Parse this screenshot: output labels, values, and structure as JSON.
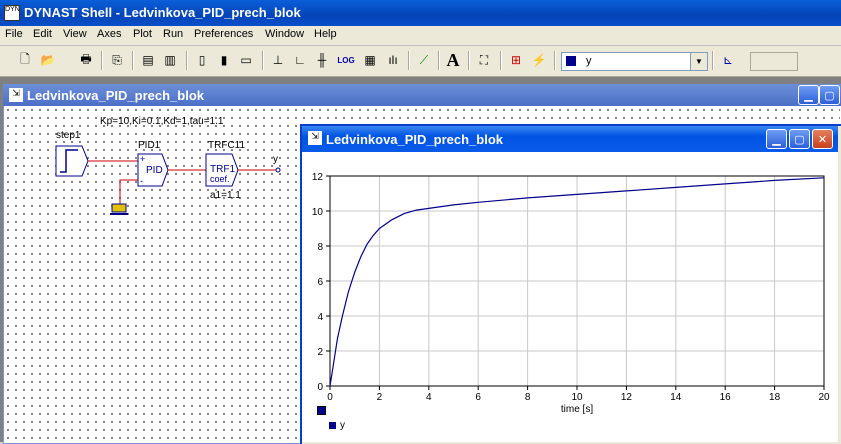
{
  "app": {
    "title": "DYNAST Shell - Ledvinkova_PID_prech_blok",
    "icon": "dynast-app-icon"
  },
  "menu": [
    "File",
    "Edit",
    "View",
    "Axes",
    "Plot",
    "Run",
    "Preferences",
    "Window",
    "Help"
  ],
  "toolbar": {
    "variable_select": "y",
    "variable_color": "#00008b"
  },
  "schematic_window": {
    "title": "Ledvinkova_PID_prech_blok",
    "params": "Kp=10,Ki=0.1,Kd=1,tau=1.1",
    "blocks": {
      "step": "step1",
      "pid_name": "PID1",
      "pid_label": "PID",
      "trf_name": "TRFC11",
      "trf_label1": "TRF1",
      "trf_label2": "coef.",
      "trf_param": "a1=1.1",
      "output": "y"
    }
  },
  "plot_window": {
    "title": "Ledvinkova_PID_prech_blok",
    "legend": "y"
  },
  "chart_data": {
    "type": "line",
    "xlabel": "time [s]",
    "ylabel": "",
    "xlim": [
      0,
      20
    ],
    "ylim": [
      0,
      12
    ],
    "xticks": [
      0,
      2,
      4,
      6,
      8,
      10,
      12,
      14,
      16,
      18,
      20
    ],
    "yticks": [
      0,
      2,
      4,
      6,
      8,
      10,
      12
    ],
    "grid": true,
    "series": [
      {
        "name": "y",
        "color": "#00008b",
        "x": [
          0,
          0.1,
          0.3,
          0.5,
          0.75,
          1,
          1.25,
          1.5,
          1.75,
          2,
          2.5,
          3,
          3.5,
          4,
          5,
          6,
          8,
          10,
          12,
          14,
          16,
          18,
          20
        ],
        "y": [
          0,
          0.9,
          2.7,
          4.0,
          5.4,
          6.5,
          7.4,
          8.1,
          8.6,
          9.0,
          9.5,
          9.85,
          10.05,
          10.15,
          10.35,
          10.5,
          10.75,
          10.95,
          11.15,
          11.35,
          11.55,
          11.75,
          11.9
        ]
      }
    ]
  }
}
